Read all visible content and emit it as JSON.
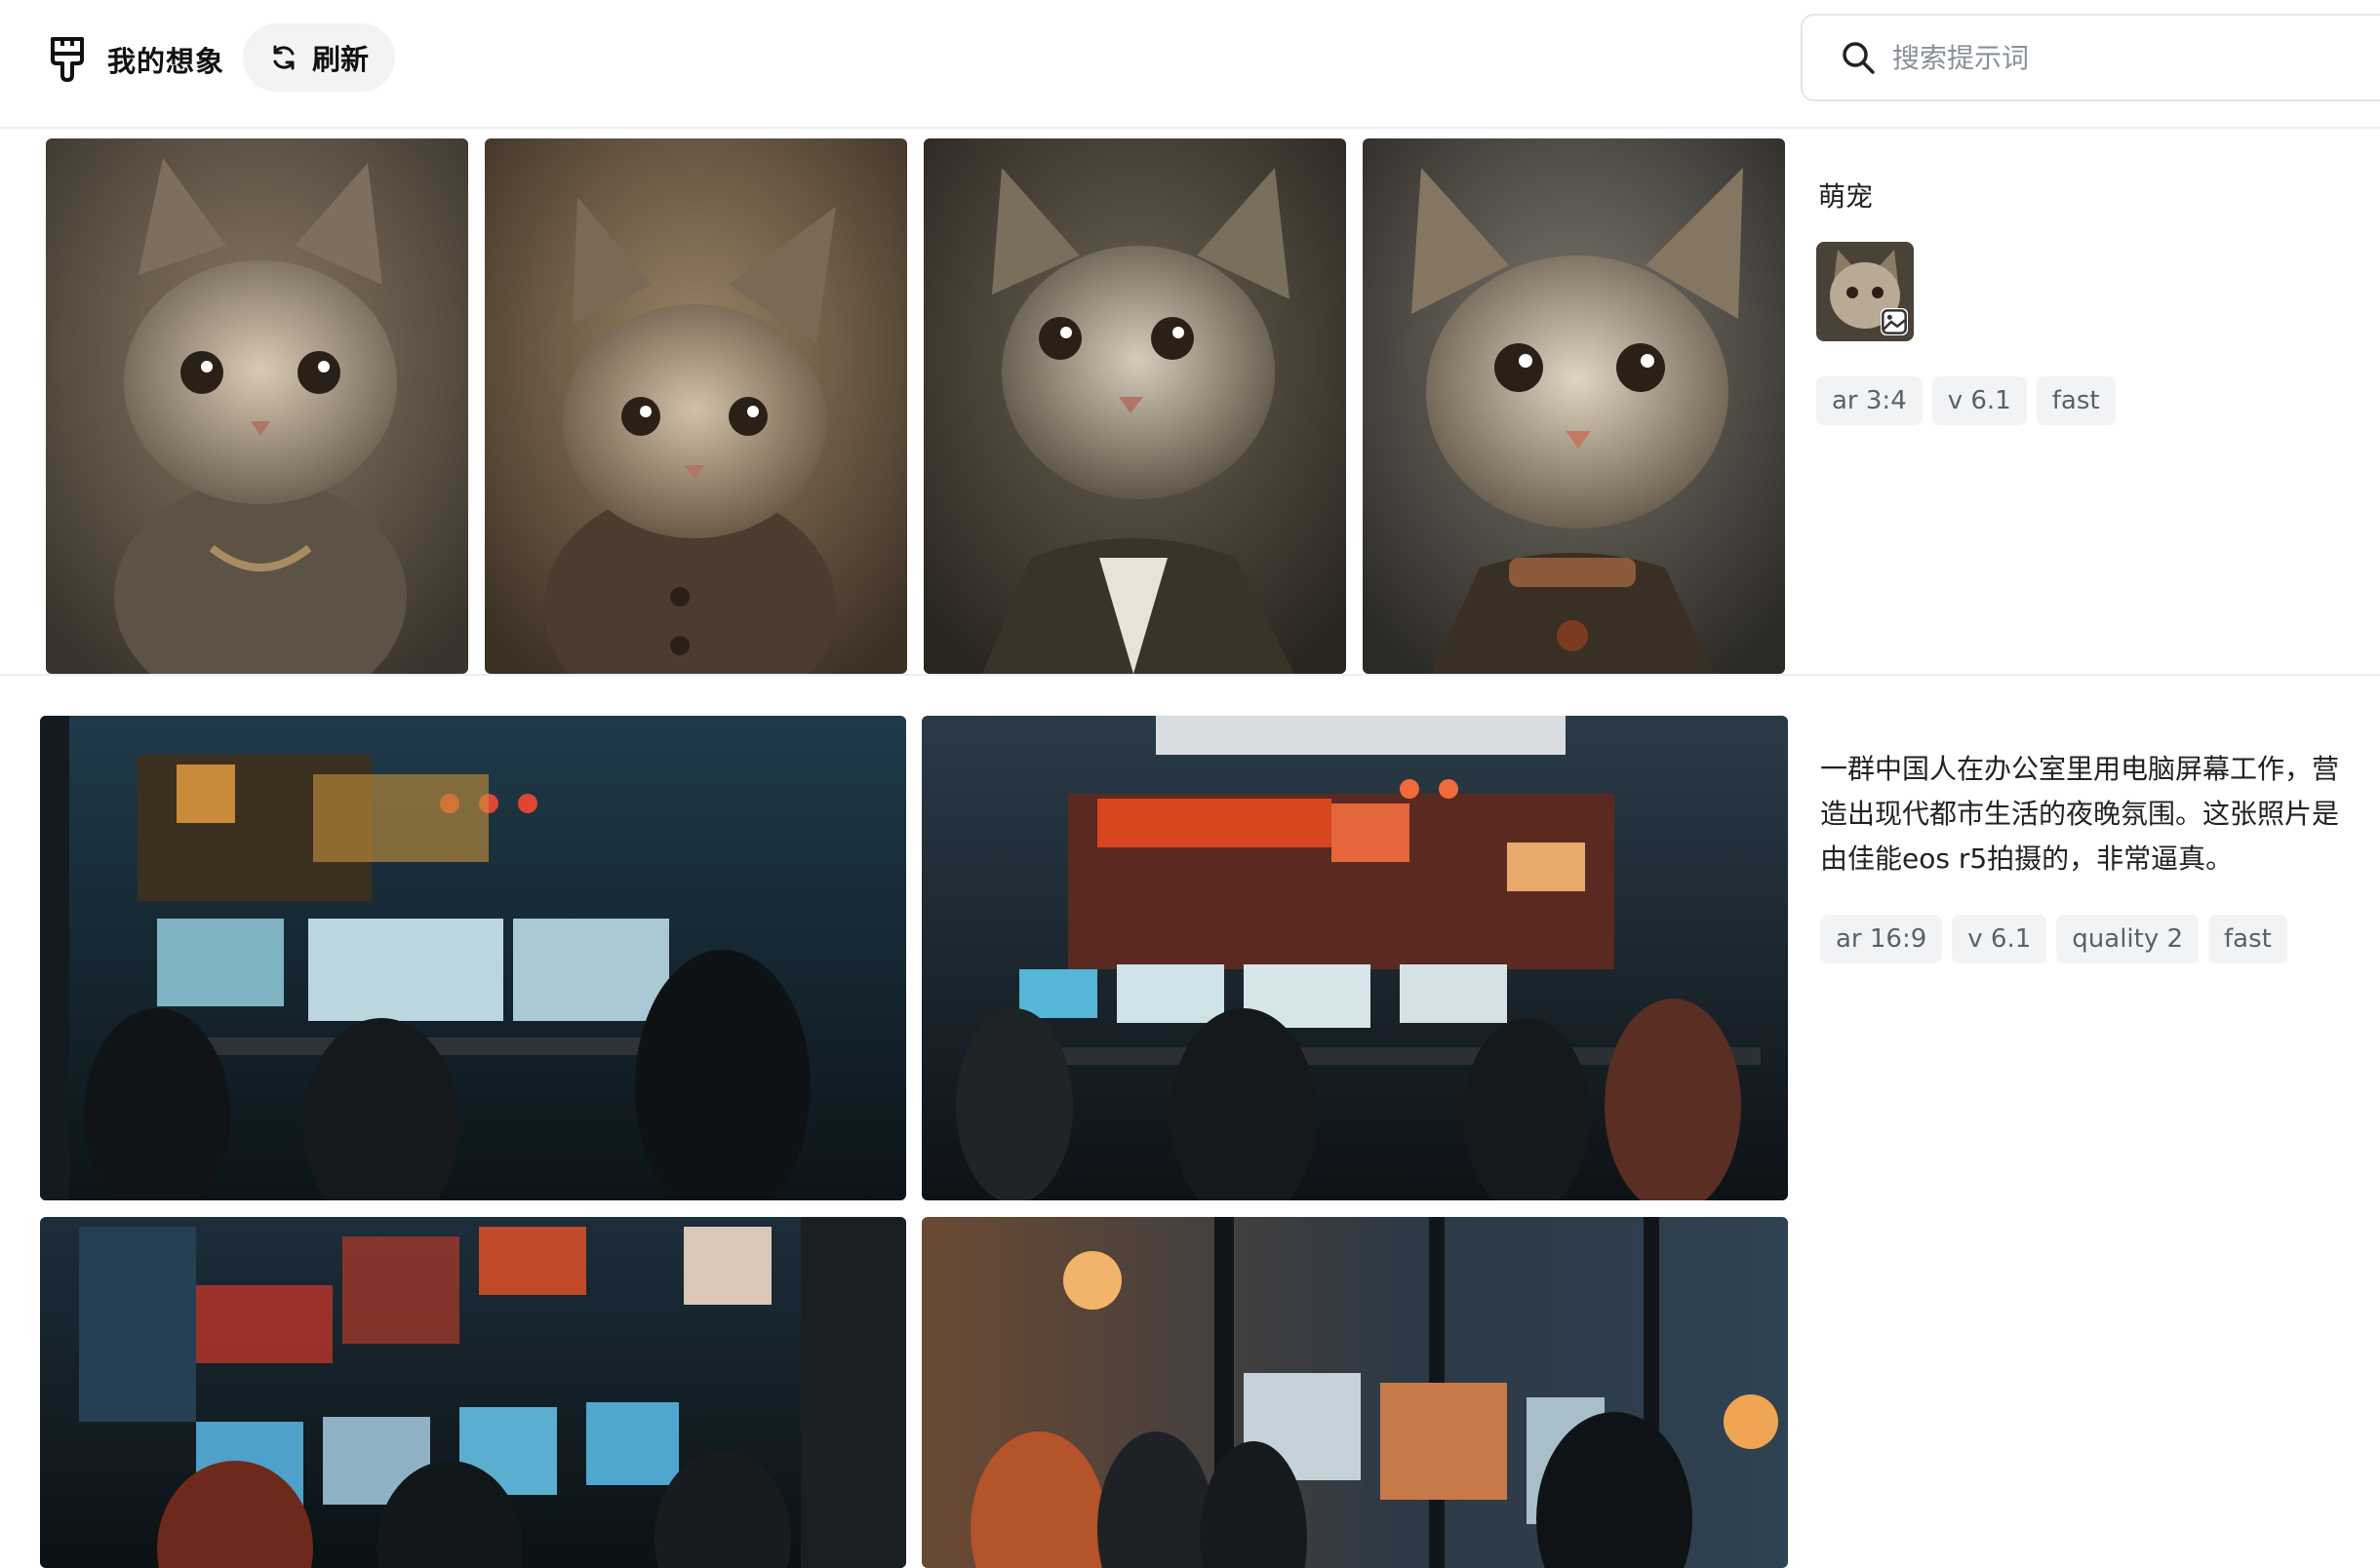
{
  "header": {
    "title": "我的想象",
    "refresh_label": "刷新",
    "search_placeholder": "搜索提示词"
  },
  "posts": [
    {
      "title": "萌宠",
      "tags": [
        "ar 3:4",
        "v 6.1",
        "fast"
      ]
    },
    {
      "prompt": "一群中国人在办公室里用电脑屏幕工作，营造出现代都市生活的夜晚氛围。这张照片是由佳能eos r5拍摄的，非常逼真。",
      "tags": [
        "ar 16:9",
        "v 6.1",
        "quality 2",
        "fast"
      ]
    }
  ],
  "icons": {
    "brand": "brush-icon",
    "refresh": "refresh-icon",
    "search": "search-icon",
    "thumb_badge": "image-icon"
  }
}
